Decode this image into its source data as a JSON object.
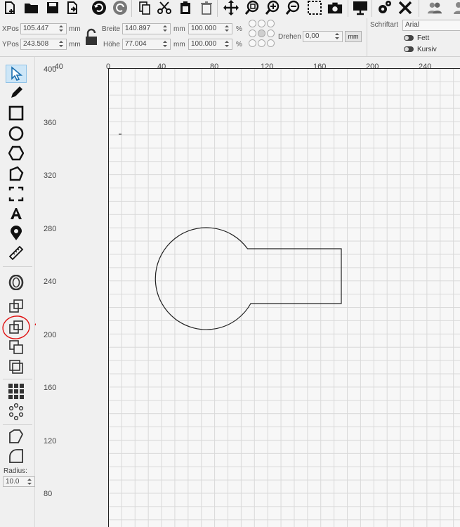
{
  "toolbar": {
    "icons": [
      "new-file-icon",
      "open-folder-icon",
      "save-icon",
      "export-icon",
      "undo-icon",
      "redo-icon",
      "copy-icon",
      "cut-icon",
      "paste-icon",
      "delete-icon",
      "move-icon",
      "zoom-fit-icon",
      "zoom-in-icon",
      "zoom-out-icon",
      "select-frame-icon",
      "camera-icon",
      "monitor-icon",
      "settings-icon",
      "tools-icon",
      "users-icon"
    ]
  },
  "props": {
    "xpos_label": "XPos",
    "xpos_value": "105.447",
    "xpos_unit": "mm",
    "ypos_label": "YPos",
    "ypos_value": "243.508",
    "ypos_unit": "mm",
    "width_label": "Breite",
    "width_value": "140.897",
    "width_unit": "mm",
    "height_label": "Höhe",
    "height_value": "77.004",
    "height_unit": "mm",
    "scale_x_value": "100.000",
    "scale_y_value": "100.000",
    "percent": "%",
    "rotate_label": "Drehen",
    "rotate_value": "0,00",
    "rotate_unit": "mm",
    "font_label": "Schriftart",
    "font_value": "Arial",
    "bold_label": "Fett",
    "italic_label": "Kursiv"
  },
  "left_panel": {
    "radius_label": "Radius:",
    "radius_value": "10.0"
  },
  "ruler": {
    "h_ticks": [
      "-40",
      "0",
      "40",
      "80",
      "120",
      "160",
      "200",
      "240"
    ],
    "v_ticks": [
      "400",
      "360",
      "320",
      "280",
      "240",
      "200",
      "160",
      "120",
      "80"
    ]
  },
  "colors": {
    "annotation": "#e01010",
    "shape_stroke": "#222222",
    "selected_tool": "#cde6f7"
  }
}
